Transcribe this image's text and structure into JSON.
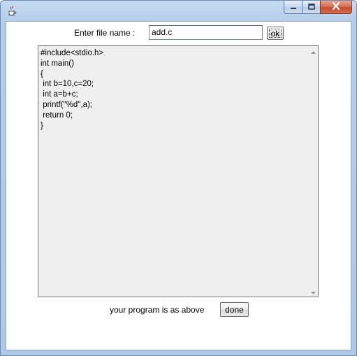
{
  "window": {
    "icon": "java-cup-icon",
    "controls": [
      "minimize-icon",
      "maximize-icon",
      "close-icon"
    ]
  },
  "form": {
    "filename_label": "Enter file name :",
    "filename_value": "add.c",
    "ok_label": "ok"
  },
  "code": {
    "lines": [
      "#include<stdio.h>",
      "int main()",
      "{",
      " int b=10,c=20;",
      " int a=b+c;",
      " printf(\"%d\",a);",
      " return 0;",
      "}"
    ]
  },
  "footer": {
    "status_text": "your program is as above",
    "done_label": "done"
  }
}
